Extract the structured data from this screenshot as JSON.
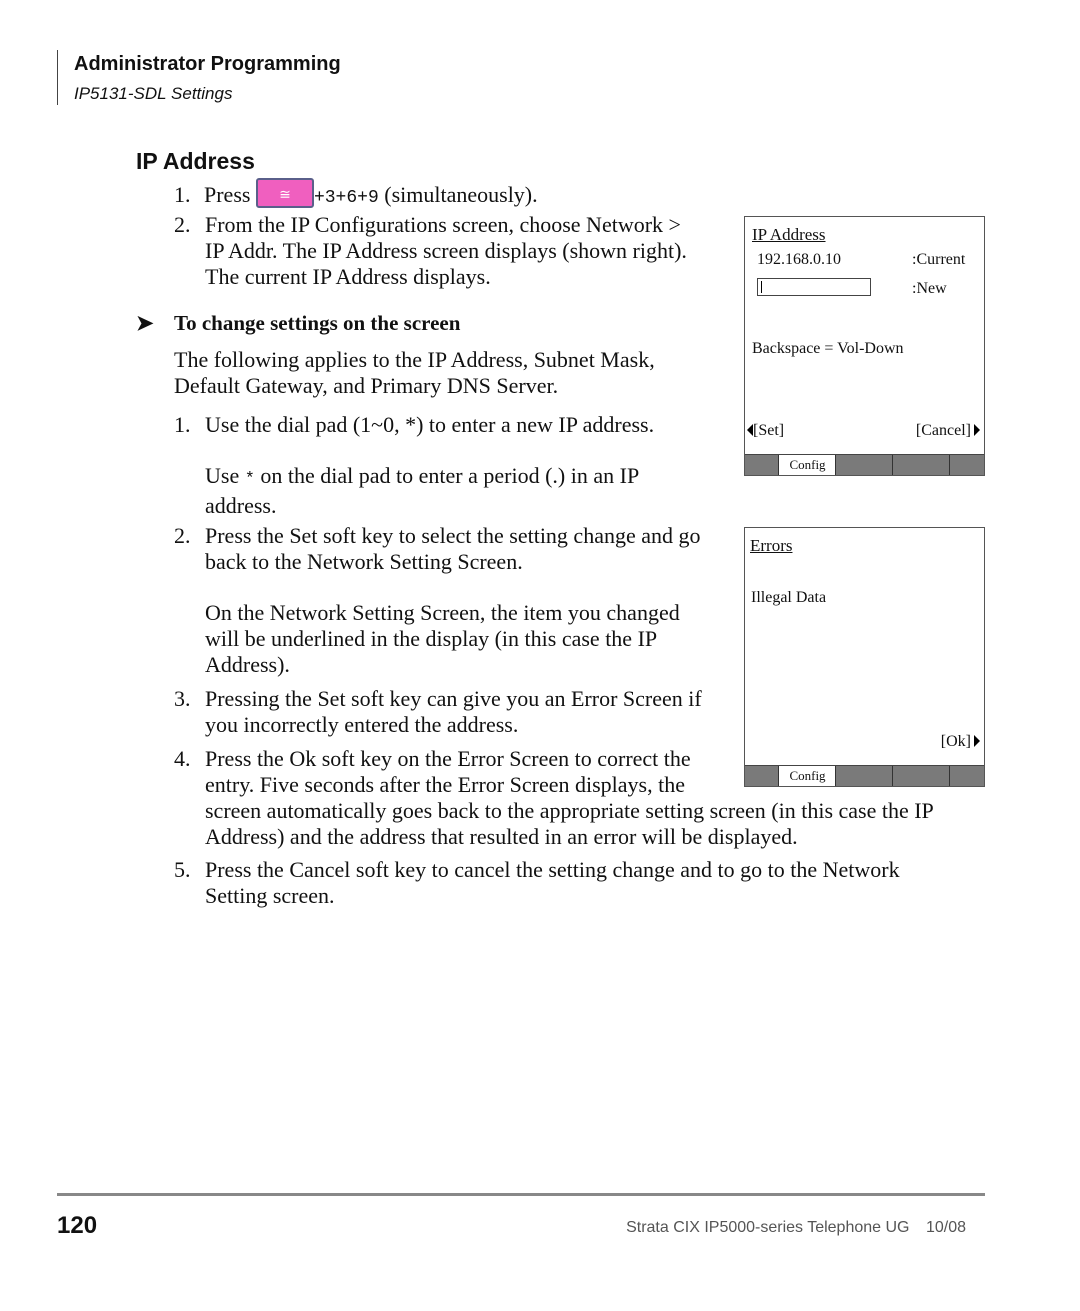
{
  "header": {
    "title": "Administrator Programming",
    "subtitle": "IP5131-SDL Settings"
  },
  "section": {
    "title": "IP Address",
    "steps": [
      {
        "num": "1.",
        "prefix": "Press",
        "key_icon": "speaker-key-icon",
        "key_sequence": "+3+6+9",
        "suffix": " (simultaneously)."
      },
      {
        "num": "2.",
        "lines": [
          "From the IP Configurations screen, choose Network >",
          "IP Addr. The IP Address screen displays (shown right).",
          "The current IP Address displays."
        ]
      }
    ],
    "procedure_title": "To change settings on the screen",
    "procedure_intro": [
      "The following applies to the IP Address, Subnet Mask,",
      "Default Gateway, and Primary DNS Server."
    ],
    "procedure_steps": [
      {
        "num": "1.",
        "lines": [
          "Use the dial pad (1~0, *) to enter a new IP address."
        ],
        "note_prefix": "Use",
        "note_key": "*",
        "note_lines": [
          " on the dial pad to enter a period (.) in an IP",
          "address."
        ]
      },
      {
        "num": "2.",
        "lines": [
          "Press the Set soft key to select the setting change and go",
          "back to the Network Setting Screen."
        ],
        "note_lines": [
          "On the Network Setting Screen, the item you changed",
          "will be underlined in the display (in this case the IP",
          "Address)."
        ]
      },
      {
        "num": "3.",
        "lines": [
          "Pressing the Set soft key can give you an Error Screen if",
          "you incorrectly entered the address."
        ]
      },
      {
        "num": "4.",
        "lines": [
          "Press the Ok soft key on the Error Screen to correct the",
          "entry. Five seconds after the Error Screen displays, the",
          "screen automatically goes back to the appropriate setting screen (in this case the IP",
          "Address) and the address that resulted in an error will be displayed."
        ]
      },
      {
        "num": "5.",
        "lines": [
          "Press the Cancel soft key to cancel the setting change and to go to the Network",
          "Setting screen."
        ]
      }
    ]
  },
  "screens": {
    "ip_address": {
      "title": "IP Address",
      "current_value": "192.168.0.10",
      "current_label": ":Current",
      "new_value": "",
      "new_label": ":New",
      "hint": "Backspace = Vol-Down",
      "softkey_left": "[Set]",
      "softkey_right": "[Cancel]",
      "tab": "Config"
    },
    "errors": {
      "title": "Errors",
      "message": "Illegal Data",
      "softkey_right": "[Ok]",
      "tab": "Config"
    }
  },
  "footer": {
    "page_number": "120",
    "doc_title": "Strata CIX IP5000-series Telephone UG",
    "date": "10/08"
  }
}
